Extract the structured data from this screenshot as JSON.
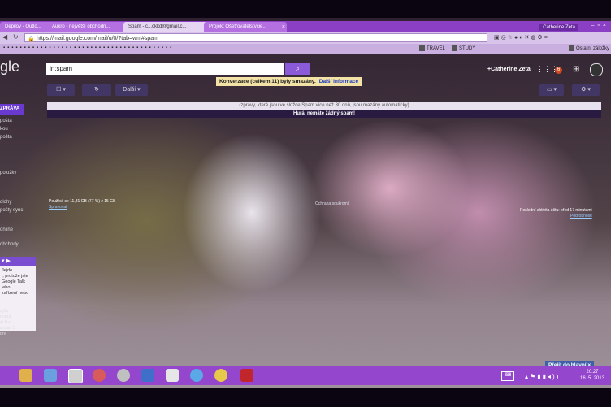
{
  "tabs": [
    {
      "label": "Depilov - Outlo...",
      "active": false
    },
    {
      "label": "Aukro - největší obchodn...",
      "active": false
    },
    {
      "label": "Spam - c...ckkd@gmail.c...",
      "active": true
    },
    {
      "label": "Projekt Ošetřovatelstvcie...",
      "active": false
    }
  ],
  "window": {
    "user": "Catherine Zeta"
  },
  "address": {
    "url": "https://mail.google.com/mail/u/0/?tab=wm#spam"
  },
  "bookmarks": [
    {
      "label": "TRAVEL"
    },
    {
      "label": "STUDY"
    },
    {
      "label": "Ostatní záložky"
    }
  ],
  "search": {
    "query": "in:spam"
  },
  "header": {
    "user_name": "+Catherine Zeta",
    "notifications": "6"
  },
  "toolbar": {
    "more_label": "Další"
  },
  "toast": {
    "text": "Konverzace (celkem 11) byly smazány.",
    "link": "Další informace"
  },
  "info": {
    "auto_delete": "(zprávy, které jsou ve složce Spam více než 30 dnů, jsou mazány automaticky)",
    "empty": "Hurá, nemáte žádný spam!"
  },
  "sidebar": {
    "compose": "ZPRÁVA",
    "items": [
      "pošta",
      "kou",
      "pošta",
      "položky",
      "dlohy",
      "pošty sync",
      "online",
      "obchody"
    ]
  },
  "footer": {
    "usage": "Používá se 11,81 GB (77 %) z 15 GB",
    "manage": "Spravovat",
    "privacy": "Ochrana soukromí",
    "activity": "Poslední aktivita účtu: před 17 minutami",
    "details": "Podrobnosti"
  },
  "chat": {
    "lines": [
      "Jejde",
      "i, protože jste",
      "Google Talk",
      "jeho",
      "zařízení nebo"
    ],
    "lower": [
      "ujíte",
      "ncnur.",
      "el Bur.",
      "assav 5",
      "dre"
    ]
  },
  "goto_inbox": "Přejít do hlavní",
  "clock": {
    "time": "20:27",
    "date": "16. 5. 2013"
  }
}
